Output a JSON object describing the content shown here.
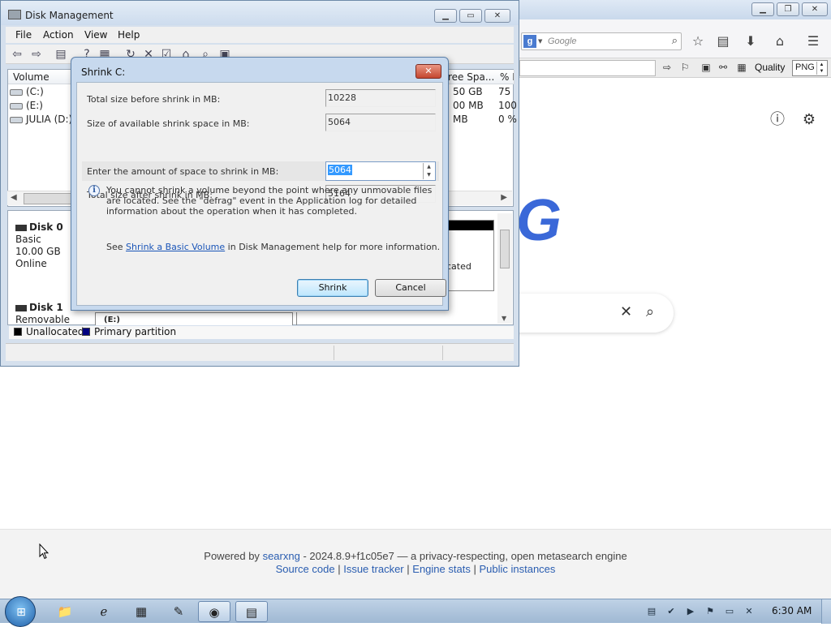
{
  "browser": {
    "search_placeholder": "Google",
    "quality_label": "Quality",
    "format_value": "PNG",
    "logo_letter": "G",
    "footer": {
      "powered_by": "Powered by",
      "searxng_link": "searxng",
      "version_text": "- 2024.8.9+f1c05e7 — a privacy-respecting, open metasearch engine",
      "source_code": "Source code",
      "issue_tracker": "Issue tracker",
      "engine_stats": "Engine stats",
      "public_instances": "Public instances",
      "separator": "|"
    }
  },
  "disk_mgmt": {
    "title": "Disk Management",
    "menu": [
      "File",
      "Action",
      "View",
      "Help"
    ],
    "columns": {
      "volume": "Volume",
      "free_space": "ree Spa...",
      "pct_free": "% F"
    },
    "volumes": [
      {
        "name": "(C:)",
        "free": "50 GB",
        "pct": "75"
      },
      {
        "name": "(E:)",
        "free": "00 MB",
        "pct": "100"
      },
      {
        "name": "JULIA (D:)",
        "free": "MB",
        "pct": "0 %"
      }
    ],
    "disk0": {
      "name": "Disk 0",
      "type": "Basic",
      "size": "10.00 GB",
      "status": "Online",
      "partition_text": "cated"
    },
    "disk1": {
      "name": "Disk 1",
      "type": "Removable",
      "partition_label": "(E:)"
    },
    "legend": {
      "unallocated": "Unallocated",
      "primary": "Primary partition",
      "unallocated_color": "#000000",
      "primary_color": "#000080"
    }
  },
  "shrink": {
    "title": "Shrink C:",
    "close_label": "✕",
    "rows": [
      {
        "label": "Total size before shrink in MB:",
        "value": "10228"
      },
      {
        "label": "Size of available shrink space in MB:",
        "value": "5064"
      },
      {
        "label": "Enter the amount of space to shrink in MB:",
        "value": "5064"
      },
      {
        "label": "Total size after shrink in MB:",
        "value": "5164"
      }
    ],
    "info_text": "You cannot shrink a volume beyond the point where any unmovable files are located. See the \"defrag\" event in the Application log for detailed information about the operation when it has completed.",
    "see_prefix": "See",
    "see_link": "Shrink a Basic Volume",
    "see_suffix": "in Disk Management help for more information.",
    "shrink_button": "Shrink",
    "cancel_button": "Cancel"
  },
  "taskbar": {
    "clock": "6:30 AM"
  },
  "colors": {
    "accent": "#3a68d8",
    "selection": "#3399ff",
    "link": "#2a5db0"
  }
}
